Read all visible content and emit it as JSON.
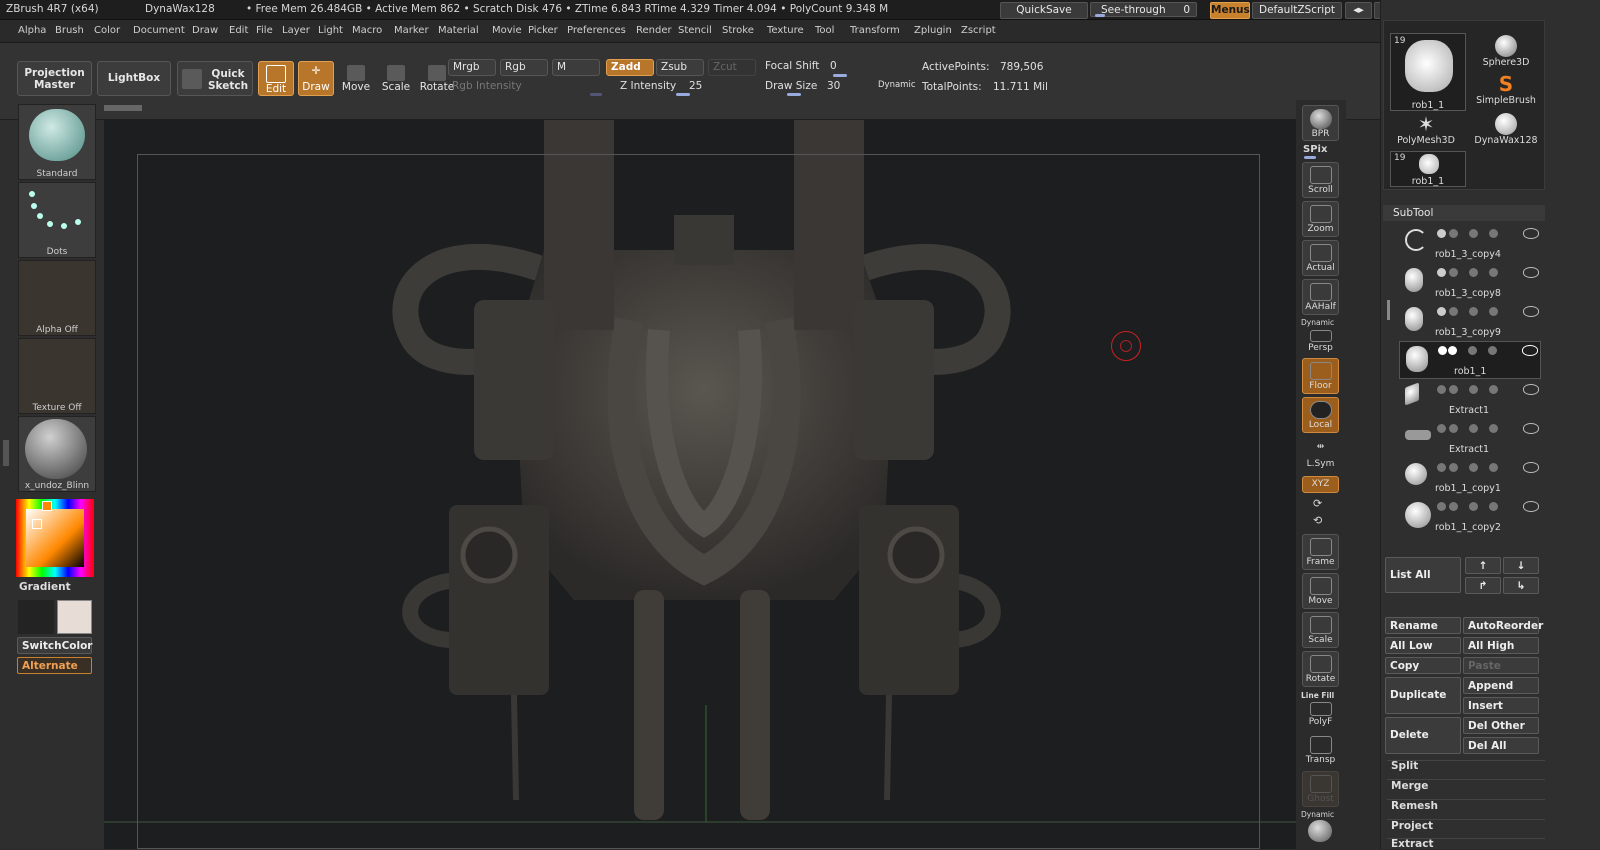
{
  "titlebar": {
    "app": "ZBrush 4R7 (x64)",
    "tool": "DynaWax128",
    "stats": "• Free Mem 26.484GB • Active Mem 862 • Scratch Disk 476 • ZTime 6.843 RTime 4.329 Timer 4.094 • PolyCount 9.348 M",
    "quicksave": "QuickSave",
    "seethrough_label": "See-through",
    "seethrough_value": "0",
    "menus": "Menus",
    "script": "DefaultZScript"
  },
  "menubar": [
    "Alpha",
    "Brush",
    "Color",
    "Document",
    "Draw",
    "Edit",
    "File",
    "Layer",
    "Light",
    "Macro",
    "Marker",
    "Material",
    "Movie",
    "Picker",
    "Preferences",
    "Render",
    "Stencil",
    "Stroke",
    "Texture",
    "Tool",
    "Transform",
    "Zplugin",
    "Zscript"
  ],
  "shelf": {
    "projection_master": "Projection Master",
    "lightbox": "LightBox",
    "quick_sketch": "Quick Sketch",
    "edit": "Edit",
    "draw": "Draw",
    "move": "Move",
    "scale": "Scale",
    "rotate": "Rotate",
    "mrgb": "Mrgb",
    "rgb": "Rgb",
    "m": "M",
    "zadd": "Zadd",
    "zsub": "Zsub",
    "zcut": "Zcut",
    "rgb_intensity": "Rgb Intensity",
    "focal_shift_label": "Focal Shift",
    "focal_shift_value": "0",
    "z_intensity_label": "Z Intensity",
    "z_intensity_value": "25",
    "draw_size_label": "Draw Size",
    "draw_size_value": "30",
    "dynamic": "Dynamic",
    "active_points_label": "ActivePoints:",
    "active_points_value": "789,506",
    "total_points_label": "TotalPoints:",
    "total_points_value": "11.711 Mil"
  },
  "leftpanel": {
    "brush": "Standard",
    "stroke": "Dots",
    "alpha": "Alpha Off",
    "texture": "Texture Off",
    "material": "x_undoz_Blinn",
    "gradient": "Gradient",
    "switchcolor": "SwitchColor",
    "alternate": "Alternate"
  },
  "rightstrip": [
    "BPR",
    "SPix",
    "Scroll",
    "Zoom",
    "Actual",
    "AAHalf",
    "Persp",
    "Floor",
    "Local",
    "L.Sym",
    "XYZ",
    "Frame",
    "Move",
    "Scale",
    "Rotate",
    "PolyF",
    "Transp",
    "Ghost",
    "Dynamic"
  ],
  "rightstrip_extra": {
    "dynamic_label": "Dynamic",
    "line_fill": "Line Fill"
  },
  "toolpanel": {
    "tools": [
      {
        "name": "rob1_1",
        "count": "19"
      },
      {
        "name": "Sphere3D"
      },
      {
        "name": "SimpleBrush"
      },
      {
        "name": "PolyMesh3D"
      },
      {
        "name": "DynaWax128"
      },
      {
        "name": "rob1_1",
        "count": "19"
      }
    ],
    "subtool_title": "SubTool",
    "subtools": [
      "rob1_3_copy4",
      "rob1_3_copy8",
      "rob1_3_copy9",
      "rob1_1",
      "Extract1",
      "Extract1",
      "rob1_1_copy1",
      "rob1_1_copy2"
    ],
    "list_all": "List All",
    "buttons": {
      "rename": "Rename",
      "autoreorder": "AutoReorder",
      "all_low": "All Low",
      "all_high": "All High",
      "copy": "Copy",
      "paste": "Paste",
      "duplicate": "Duplicate",
      "append": "Append",
      "insert": "Insert",
      "delete": "Delete",
      "del_other": "Del Other",
      "del_all": "Del All"
    },
    "sections": [
      "Split",
      "Merge",
      "Remesh",
      "Project",
      "Extract"
    ]
  },
  "colors": {
    "accent": "#c8822d",
    "canvas_bg": "#1c1e1f",
    "panel_bg": "#2f2f2f"
  }
}
